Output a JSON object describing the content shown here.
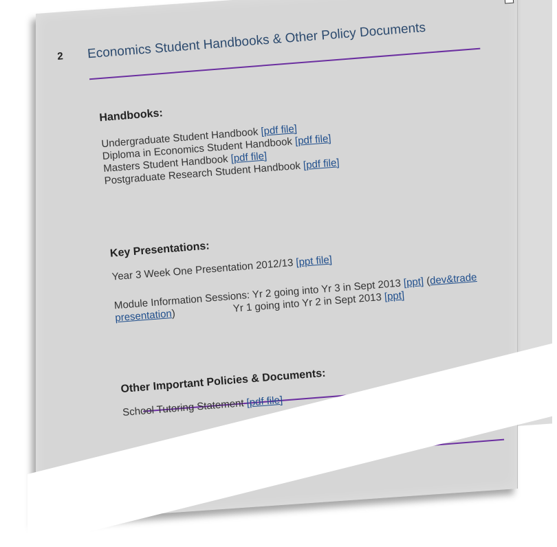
{
  "section": {
    "number": "2",
    "title": "Economics Student Handbooks & Other Policy Documents"
  },
  "handbooks": {
    "heading": "Handbooks:",
    "items": [
      {
        "label": "Undergraduate Student Handbook",
        "link": "[pdf file]"
      },
      {
        "label": "Diploma in Economics Student Handbook",
        "link": "[pdf file]"
      },
      {
        "label": "Masters Student Handbook",
        "link": "[pdf file]"
      },
      {
        "label": "Postgraduate Research Student Handbook",
        "link": "[pdf file]"
      }
    ]
  },
  "presentations": {
    "heading": "Key Presentations:",
    "year3": {
      "label": "Year 3 Week One Presentation 2012/13",
      "link": "[ppt file]"
    },
    "module": {
      "label": "Module Information Sessions: Yr 2 going into Yr 3 in Sept 2013",
      "link": "[ppt]",
      "paren_open": "(",
      "dev_link_a": "dev&trade",
      "dev_link_b": "presentation",
      "paren_close": ")",
      "yr1_label": "Yr 1 going into Yr 2 in Sept 2013",
      "yr1_link": "[ppt]"
    }
  },
  "other": {
    "heading": "Other Important Policies & Documents:",
    "items": [
      {
        "label": "School Tutoring Statement",
        "link": "[pdf file]"
      }
    ]
  },
  "colors": {
    "rule": "#6b2fa0",
    "title": "#2c4a6e",
    "link": "#1f4e8c",
    "panel": "#d6d6d6"
  }
}
